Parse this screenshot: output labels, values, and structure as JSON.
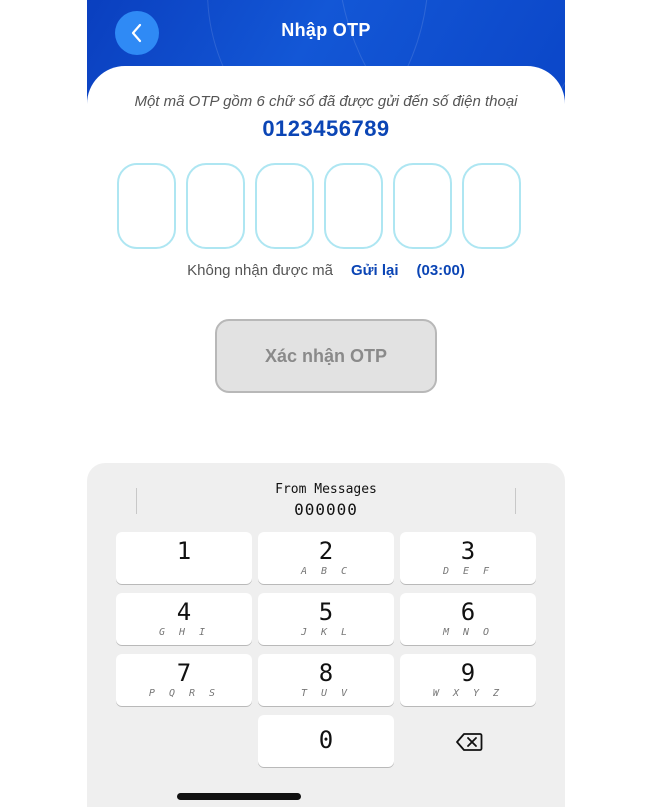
{
  "header": {
    "title": "Nhập OTP"
  },
  "main": {
    "description": "Một mã OTP gồm 6 chữ số đã được gửi đến số điện thoại",
    "phone": "0123456789",
    "otp_digits": [
      "",
      "",
      "",
      "",
      "",
      ""
    ],
    "not_received": "Không nhận được mã",
    "resend": "Gửi lại",
    "timer": "(03:00)",
    "confirm_label": "Xác nhận OTP"
  },
  "keyboard": {
    "suggestion_source": "From Messages",
    "suggestion_code": "000000",
    "keys": [
      {
        "digit": "1",
        "letters": ""
      },
      {
        "digit": "2",
        "letters": "A B C"
      },
      {
        "digit": "3",
        "letters": "D E F"
      },
      {
        "digit": "4",
        "letters": "G H I"
      },
      {
        "digit": "5",
        "letters": "J K L"
      },
      {
        "digit": "6",
        "letters": "M N O"
      },
      {
        "digit": "7",
        "letters": "P Q R S"
      },
      {
        "digit": "8",
        "letters": "T U V"
      },
      {
        "digit": "9",
        "letters": "W X Y Z"
      },
      {
        "digit": "0",
        "letters": ""
      }
    ],
    "delete_icon": "backspace-icon"
  },
  "colors": {
    "header_blue": "#1357d6",
    "accent_blue": "#0b45b5",
    "otp_border": "#aee6f2"
  }
}
